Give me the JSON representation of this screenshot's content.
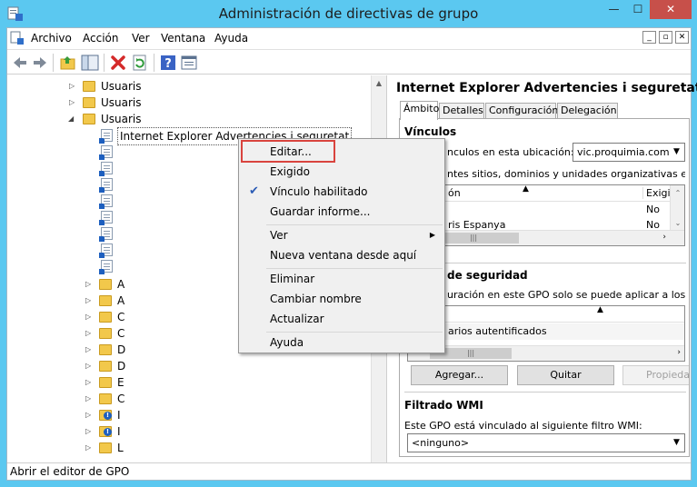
{
  "window": {
    "title": "Administración de directivas de grupo",
    "min_glyph": "—",
    "max_glyph": "☐",
    "close_glyph": "✕"
  },
  "menubar": {
    "items": [
      "Archivo",
      "Acción",
      "Ver",
      "Ventana",
      "Ayuda"
    ]
  },
  "tree": {
    "rows": [
      {
        "label": "Usuaris"
      },
      {
        "label": "Usuaris"
      },
      {
        "label": "Usuaris"
      },
      {
        "label": "Internet Explorer Advertencies i seguretat"
      }
    ],
    "truncated_labels": [
      "A",
      "A",
      "C",
      "C",
      "D",
      "D",
      "E",
      "C",
      "I",
      "I",
      "L"
    ]
  },
  "right_pane": {
    "title": "Internet Explorer Advertencies i seguretat",
    "tabs": [
      "Ámbito",
      "Detalles",
      "Configuración",
      "Delegación"
    ],
    "links_section": "Vínculos",
    "links_location_text": "nculos en esta ubicación:",
    "links_location_value": "vic.proquimia.com",
    "links_desc": "ntes sitios, dominios y unidades organizativas están vir",
    "links_col1": "ón",
    "links_col2": "Exigi",
    "links_rows": [
      {
        "name": "",
        "value": "No"
      },
      {
        "name": "ris Espanya",
        "value": "No"
      }
    ],
    "security_section": "de seguridad",
    "security_desc": "uración en este GPO solo se puede aplicar a los grupos",
    "security_row": "arios autentificados",
    "buttons": {
      "add": "Agregar...",
      "remove": "Quitar",
      "props": "Propiedad"
    },
    "wmi_section": "Filtrado WMI",
    "wmi_desc": "Este GPO está vinculado al siguiente filtro WMI:",
    "wmi_value": "<ninguno>"
  },
  "context_menu": {
    "items": [
      {
        "label": "Editar..."
      },
      {
        "label": "Exigido"
      },
      {
        "label": "Vínculo habilitado",
        "checked": true
      },
      {
        "label": "Guardar informe..."
      },
      {
        "label": "Ver",
        "submenu": true
      },
      {
        "label": "Nueva ventana desde aquí"
      },
      {
        "label": "Eliminar"
      },
      {
        "label": "Cambiar nombre"
      },
      {
        "label": "Actualizar"
      },
      {
        "label": "Ayuda"
      }
    ]
  },
  "statusbar": {
    "text": "Abrir el editor de GPO"
  },
  "colors": {
    "titlebar": "#5bc8f0",
    "close": "#c7504a",
    "highlight": "#d9443e"
  }
}
